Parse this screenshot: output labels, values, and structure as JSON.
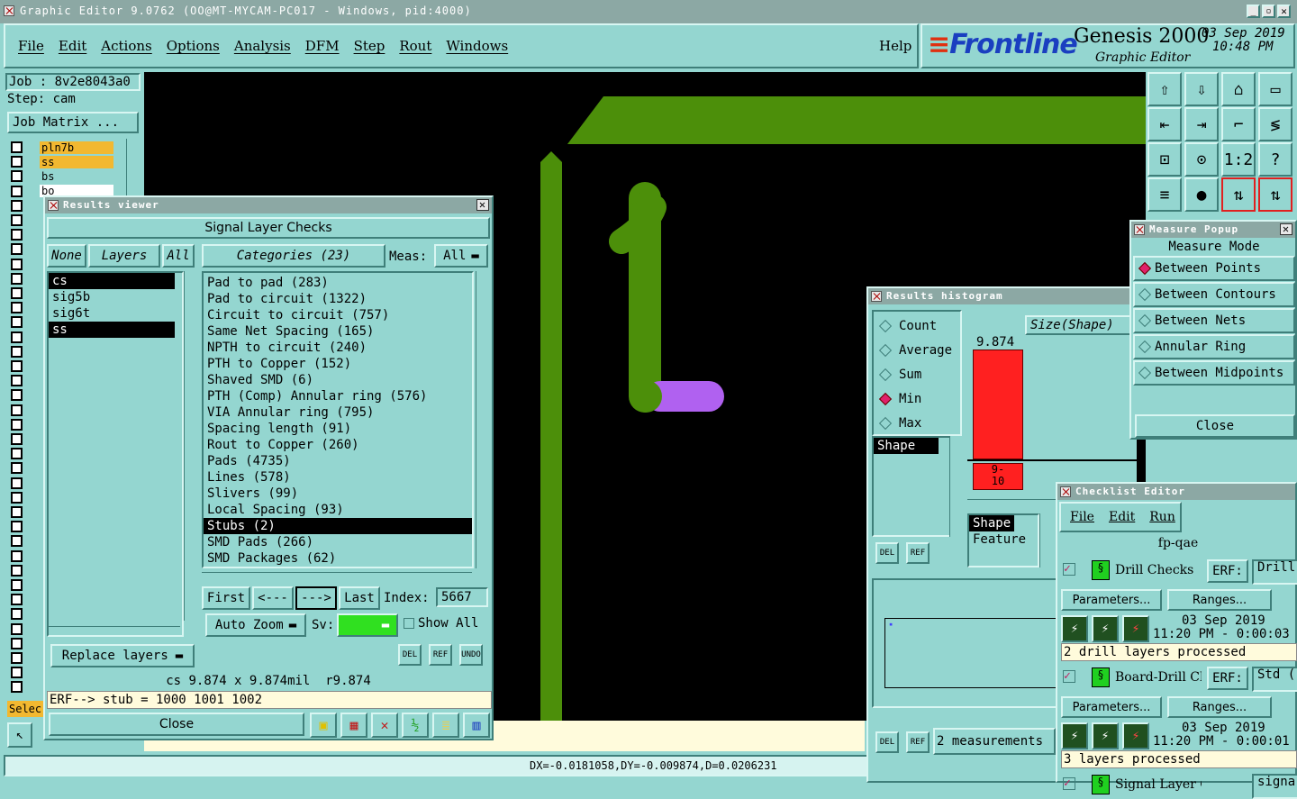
{
  "window": {
    "title": "Graphic Editor 9.0762 (OO@MT-MYCAM-PC017 - Windows, pid:4000)"
  },
  "menu": [
    "File",
    "Edit",
    "Actions",
    "Options",
    "Analysis",
    "DFM",
    "Step",
    "Rout",
    "Windows"
  ],
  "help_label": "Help",
  "brand": {
    "logo": "Frontline",
    "product": "Genesis 2000",
    "subtitle": "Graphic Editor",
    "date": "03 Sep 2019",
    "time": "10:48 PM"
  },
  "job": {
    "job_label": "Job : 8v2e8043a0",
    "step_label": "Step: cam",
    "matrix_btn": "Job Matrix ..."
  },
  "layers_panel": {
    "items": [
      "pln7b",
      "ss",
      "bs",
      "bo"
    ],
    "select_label": "Selec"
  },
  "results_viewer": {
    "title": "Results viewer",
    "header": "Signal Layer Checks",
    "none_btn": "None",
    "layers_btn": "Layers",
    "all_btn": "All",
    "categories_btn": "Categories (23)",
    "meas_label": "Meas:",
    "meas_value": "All",
    "layers": [
      "cs",
      "sig5b",
      "sig6t",
      "ss"
    ],
    "categories": [
      "Pad to pad (283)",
      "Pad to circuit (1322)",
      "Circuit to circuit (757)",
      "Same Net Spacing (165)",
      "NPTH to circuit (240)",
      "PTH to Copper (152)",
      "Shaved SMD (6)",
      "PTH (Comp) Annular ring (576)",
      "VIA Annular ring (795)",
      "Spacing length (91)",
      "Rout to Copper (260)",
      "Pads (4735)",
      "Lines (578)",
      "Slivers (99)",
      "Local Spacing (93)",
      "Stubs (2)",
      "SMD Pads (266)",
      "SMD Packages (62)"
    ],
    "selected_category": "Stubs (2)",
    "first": "First",
    "prev": "<---",
    "next": "--->",
    "last": "Last",
    "index_label": "Index:",
    "index_value": "5667",
    "auto_zoom": "Auto Zoom",
    "sv_label": "Sv:",
    "show_all": "Show All",
    "replace_layers": "Replace layers",
    "info": "cs 9.874 x 9.874mil  r9.874",
    "erf": "ERF--> stub = 1000 1001 1002",
    "close": "Close",
    "del": "DEL",
    "ref": "REF",
    "undo": "UNDO"
  },
  "measure_popup": {
    "title": "Measure Popup",
    "mode_header": "Measure Mode",
    "options": [
      "Between Points",
      "Between Contours",
      "Between Nets",
      "Annular Ring",
      "Between Midpoints"
    ],
    "selected": "Between Points",
    "close": "Close"
  },
  "histogram": {
    "title": "Results histogram",
    "options": [
      "Count",
      "Average",
      "Sum",
      "Min",
      "Max"
    ],
    "selected": "Min",
    "dropdown": "Size(Shape)",
    "list1": [
      "Shape"
    ],
    "list2": [
      "Shape",
      "Feature"
    ],
    "bar_value": "9.874",
    "bar_label": "9-\n10",
    "measurements": "2 measurements",
    "del": "DEL",
    "ref": "REF"
  },
  "checklist": {
    "title": "Checklist Editor",
    "menu": [
      "File",
      "Edit",
      "Run"
    ],
    "name": "fp-qae",
    "items": [
      {
        "name": "Drill Checks",
        "erf_label": "ERF:",
        "erf_value": "Drill",
        "params": "Parameters...",
        "ranges": "Ranges...",
        "date": "03 Sep 2019",
        "time": "11:20 PM - 0:00:03",
        "status": "2 drill layers processed"
      },
      {
        "name": "Board-Drill Che",
        "erf_label": "ERF:",
        "erf_value": "Std (",
        "params": "Parameters...",
        "ranges": "Ranges...",
        "date": "03 Sep 2019",
        "time": "11:20 PM - 0:00:01",
        "status": "3 layers processed"
      },
      {
        "name": "Signal Layer Ch",
        "erf_value": "signa"
      }
    ]
  },
  "status_bar": "DX=-0.0181058,DY=-0.009874,D=0.0206231",
  "colors": {
    "bg": "#94d6d0",
    "copper": "#4c8f0a",
    "highlight": "#b061f0",
    "bar": "#ff2020"
  }
}
